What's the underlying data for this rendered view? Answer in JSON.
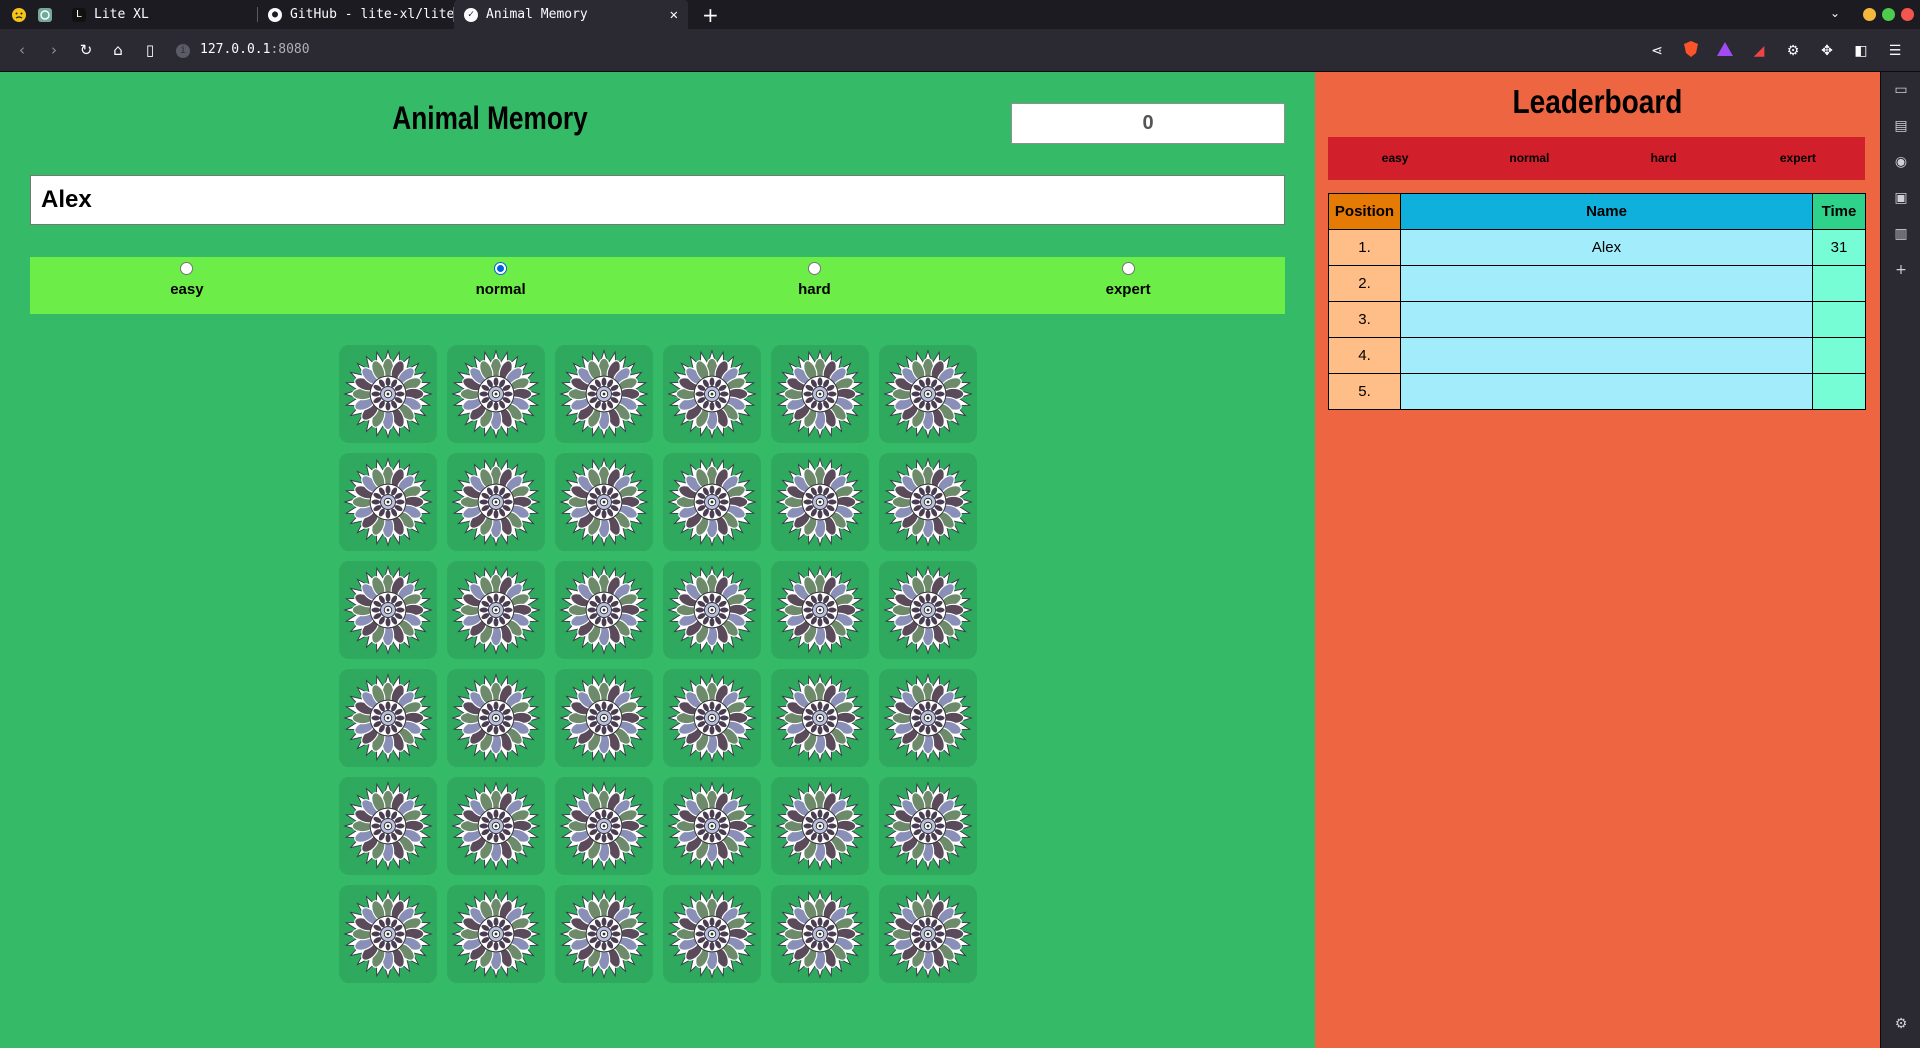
{
  "browser": {
    "tabs": [
      {
        "title": "Lite XL",
        "active": false
      },
      {
        "title": "GitHub - lite-xl/lite-xl-",
        "active": false
      },
      {
        "title": "Animal Memory",
        "active": true
      }
    ],
    "close_glyph": "✕",
    "new_tab_glyph": "+",
    "url_host": "127.0.0.1",
    "url_port": ":8080"
  },
  "game": {
    "title": "Animal Memory",
    "score": "0",
    "player_name": "Alex",
    "difficulties": [
      {
        "label": "easy",
        "selected": false
      },
      {
        "label": "normal",
        "selected": true
      },
      {
        "label": "hard",
        "selected": false
      },
      {
        "label": "expert",
        "selected": false
      }
    ],
    "card_back_icon": "mandala-card-back-icon"
  },
  "leaderboard": {
    "title": "Leaderboard",
    "tabs": [
      "easy",
      "normal",
      "hard",
      "expert"
    ],
    "headers": {
      "position": "Position",
      "name": "Name",
      "time": "Time"
    },
    "rows": [
      {
        "position": "1.",
        "name": "Alex",
        "time": "31"
      },
      {
        "position": "2.",
        "name": "",
        "time": ""
      },
      {
        "position": "3.",
        "name": "",
        "time": ""
      },
      {
        "position": "4.",
        "name": "",
        "time": ""
      },
      {
        "position": "5.",
        "name": "",
        "time": ""
      }
    ]
  },
  "colors": {
    "game_bg": "#35bb68",
    "leaderboard_bg": "#ee6641",
    "difficulty_bar": "#6ced48",
    "lb_tabs_bg": "#d11f2b"
  }
}
